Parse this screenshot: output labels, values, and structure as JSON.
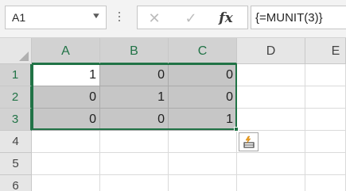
{
  "name_box": {
    "value": "A1",
    "dropdown_glyph": "▼"
  },
  "formula_bar": {
    "cancel_glyph": "✕",
    "enter_glyph": "✓",
    "insert_function_label": "fx",
    "formula": "{=MUNIT(3)}"
  },
  "columns": [
    "A",
    "B",
    "C",
    "D",
    "E"
  ],
  "rows": [
    "1",
    "2",
    "3",
    "4",
    "5",
    "6"
  ],
  "cells": [
    [
      "1",
      "0",
      "0"
    ],
    [
      "0",
      "1",
      "0"
    ],
    [
      "0",
      "0",
      "1"
    ]
  ],
  "icons": {
    "name_box_dropdown": "chevron-down-icon",
    "cancel": "close-icon",
    "enter": "check-icon",
    "quick_analysis": "quick-analysis-icon"
  },
  "colors": {
    "selection_accent": "#217346",
    "selected_cell_fill": "#c6c6c6",
    "header_fill": "#e6e6e6"
  }
}
